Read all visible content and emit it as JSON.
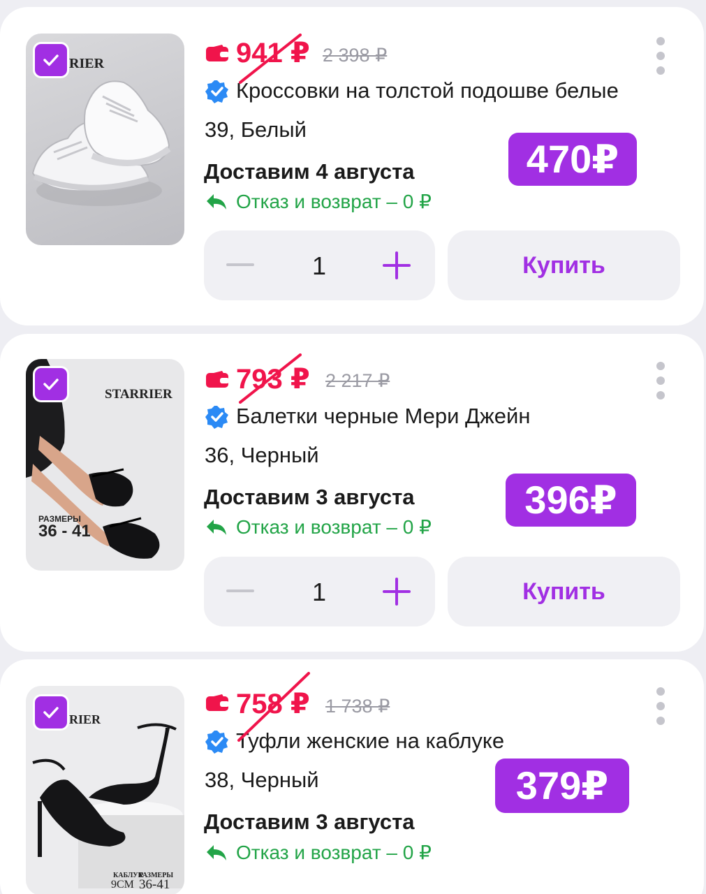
{
  "colors": {
    "accent": "#a12fe3",
    "sale_red": "#f0144b",
    "return_green": "#22a447",
    "bg": "#eeeef3"
  },
  "cards": [
    {
      "brand": "RIER",
      "sale_price": "941 ₽",
      "old_price": "2 398 ₽",
      "title": "Кроссовки на толстой подошве белые",
      "variant": "39, Белый",
      "delivery": "Доставим 4 августа",
      "return_policy": "Отказ и возврат – 0 ₽",
      "big_price": "470₽",
      "quantity": "1",
      "buy_label": "Купить"
    },
    {
      "brand": "STARRIER",
      "sizes_label": "РАЗМЕРЫ",
      "sizes_value": "36 - 41",
      "sale_price": "793 ₽",
      "old_price": "2 217 ₽",
      "title": "Балетки черные Мери Джейн",
      "variant": "36, Черный",
      "delivery": "Доставим 3 августа",
      "return_policy": "Отказ и возврат – 0 ₽",
      "big_price": "396₽",
      "quantity": "1",
      "buy_label": "Купить"
    },
    {
      "brand": "RIER",
      "heel_label": "КАБЛУК",
      "sizes_label": "РАЗМЕРЫ",
      "heel_value": "9CM",
      "sizes_value": "36-41",
      "sale_price": "758 ₽",
      "old_price": "1 738 ₽",
      "title": "Туфли женские на каблуке",
      "variant": "38, Черный",
      "delivery": "Доставим 3 августа",
      "return_policy": "Отказ и возврат – 0 ₽",
      "big_price": "379₽"
    }
  ]
}
